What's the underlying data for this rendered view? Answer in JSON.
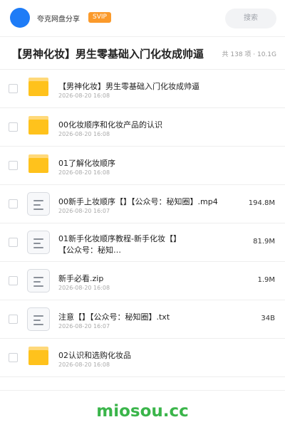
{
  "header": {
    "share_title": "夸克网盘分享",
    "svip_badge": "SVIP",
    "search_placeholder": "搜索"
  },
  "folder": {
    "title": "【男神化妆】男生零基础入门化妆成帅逼",
    "stats": "共 138 项 · 10.1G"
  },
  "items": [
    {
      "type": "folder",
      "name": "【男神化妆】男生零基础入门化妆成帅逼",
      "date": "2026-08-20 16:08",
      "size": ""
    },
    {
      "type": "folder",
      "name": "00化妆顺序和化妆产品的认识",
      "date": "2026-08-20 16:08",
      "size": ""
    },
    {
      "type": "folder",
      "name": "01了解化妆顺序",
      "date": "2026-08-20 16:08",
      "size": ""
    },
    {
      "type": "file",
      "name": "00新手上妆顺序【】【公众号：秘知圈】.mp4",
      "date": "2026-08-20 16:07",
      "size": "194.8M"
    },
    {
      "type": "file",
      "name": "01新手化妆顺序教程-新手化妆【】【公众号：秘知…",
      "date": "2026-08-20 16:07",
      "size": "81.9M"
    },
    {
      "type": "file",
      "name": "新手必看.zip",
      "date": "2026-08-20 16:08",
      "size": "1.9M"
    },
    {
      "type": "file",
      "name": "注意【】【公众号：秘知圈】.txt",
      "date": "2026-08-20 16:07",
      "size": "34B"
    },
    {
      "type": "folder",
      "name": "02认识和选购化妆品",
      "date": "2026-08-20 16:08",
      "size": ""
    }
  ],
  "watermark": "miosou.cc",
  "colors": {
    "accent": "#1e7cf7",
    "svip": "#fb9a2b",
    "folder": "#ffc21c",
    "watermark": "#3ab54a"
  }
}
